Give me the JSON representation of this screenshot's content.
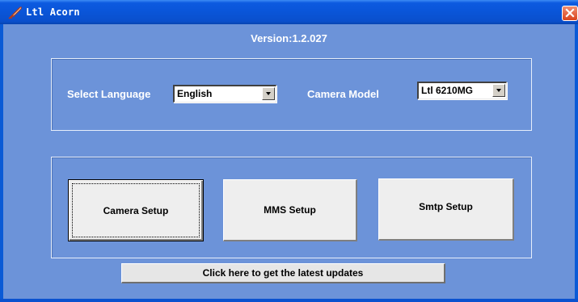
{
  "window": {
    "title": "Ltl Acorn",
    "icon": "feather-pen-icon",
    "title_bar_color": "#0a55d8",
    "client_color": "#6c93d9"
  },
  "version": "Version:1.2.027",
  "language": {
    "label": "Select Language",
    "value": "English"
  },
  "camera_model": {
    "label": "Camera Model",
    "value": "Ltl 6210MG"
  },
  "buttons": {
    "camera_setup": "Camera Setup",
    "mms_setup": "MMS Setup",
    "smtp_setup": "Smtp Setup",
    "updates": "Click here to get the latest updates"
  }
}
